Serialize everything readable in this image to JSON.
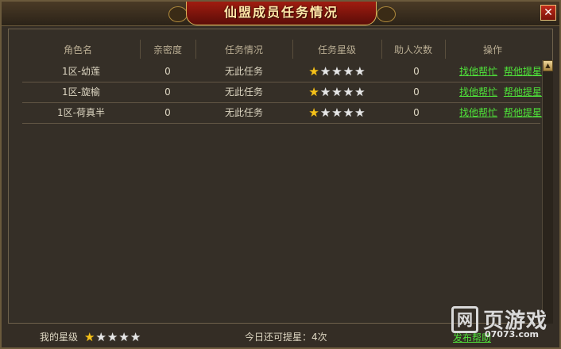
{
  "window": {
    "title": "仙盟成员任务情况",
    "close_label": "✕"
  },
  "table": {
    "headers": [
      "角色名",
      "亲密度",
      "任务情况",
      "任务星级",
      "助人次数",
      "操作"
    ],
    "rows": [
      {
        "name": "1区-幼莲",
        "intimacy": "0",
        "task_status": "无此任务",
        "stars": 1,
        "help_count": "0",
        "action_help": "找他帮忙",
        "action_raise": "帮他提星"
      },
      {
        "name": "1区-旋榆",
        "intimacy": "0",
        "task_status": "无此任务",
        "stars": 1,
        "help_count": "0",
        "action_help": "找他帮忙",
        "action_raise": "帮他提星"
      },
      {
        "name": "1区-荷真半",
        "intimacy": "0",
        "task_status": "无此任务",
        "stars": 1,
        "help_count": "0",
        "action_help": "找他帮忙",
        "action_raise": "帮他提星"
      }
    ],
    "max_stars": 5
  },
  "footer": {
    "my_stars_label": "我的星级",
    "my_stars": 1,
    "remaining_label": "今日还可提星：4次",
    "link_partial": "发布帮助"
  },
  "watermark": {
    "main": "页游戏",
    "sub": "07073.com",
    "box_char": "网"
  },
  "colors": {
    "star_on": "#f6c21b",
    "star_off": "#e6e6e6",
    "link": "#4fe23a",
    "title_banner": "#a01c10"
  }
}
